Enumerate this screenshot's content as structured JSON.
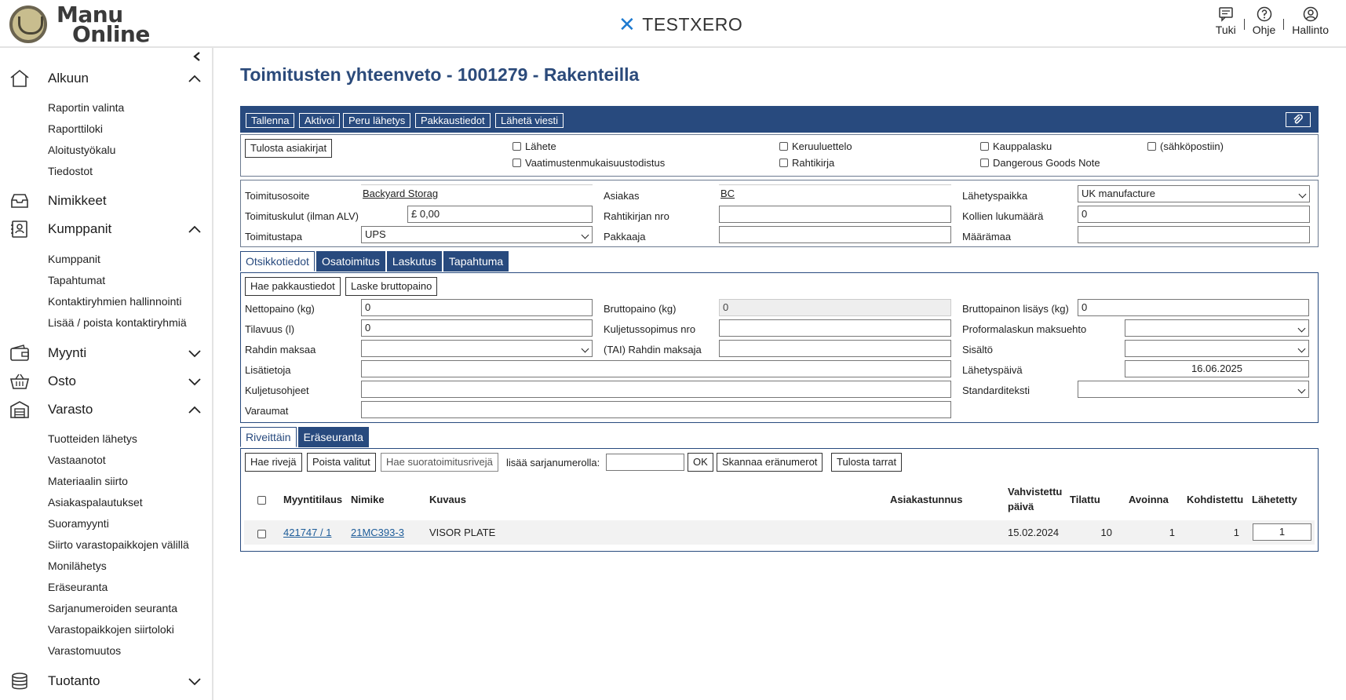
{
  "header": {
    "logo_line1": "Manu",
    "logo_line2": "Online",
    "brand": "TESTXERO",
    "links": [
      {
        "label": "Tuki",
        "icon": "chat-icon"
      },
      {
        "label": "Ohje",
        "icon": "help-icon"
      },
      {
        "label": "Hallinto",
        "icon": "user-icon"
      }
    ],
    "separator": "|"
  },
  "sidebar": {
    "sections": [
      {
        "label": "Alkuun",
        "icon": "home-icon",
        "expanded": true,
        "items": [
          "Raportin valinta",
          "Raporttiloki",
          "Aloitustyökalu",
          "Tiedostot"
        ]
      },
      {
        "label": "Nimikkeet",
        "icon": "inbox-icon"
      },
      {
        "label": "Kumppanit",
        "icon": "contacts-icon",
        "expanded": true,
        "items": [
          "Kumppanit",
          "Tapahtumat",
          "Kontaktiryhmien hallinnointi",
          "Lisää / poista kontaktiryhmiä"
        ]
      },
      {
        "label": "Myynti",
        "icon": "wallet-icon",
        "expanded": false
      },
      {
        "label": "Osto",
        "icon": "basket-icon",
        "expanded": false
      },
      {
        "label": "Varasto",
        "icon": "warehouse-icon",
        "expanded": true,
        "items": [
          "Tuotteiden lähetys",
          "Vastaanotot",
          "Materiaalin siirto",
          "Asiakaspalautukset",
          "Suoramyynti",
          "Siirto varastopaikkojen välillä",
          "Monilähetys",
          "Eräseuranta",
          "Sarjanumeroiden seuranta",
          "Varastopaikkojen siirtoloki",
          "Varastomuutos"
        ]
      },
      {
        "label": "Tuotanto",
        "icon": "database-icon",
        "expanded": false
      }
    ]
  },
  "page": {
    "title": "Toimitusten yhteenveto - 1001279 - Rakenteilla"
  },
  "toolbar": {
    "buttons": [
      "Tallenna",
      "Aktivoi",
      "Peru lähetys",
      "Pakkaustiedot",
      "Lähetä viesti"
    ],
    "attach_icon": "paperclip-icon"
  },
  "print": {
    "button": "Tulosta asiakirjat",
    "checkboxes": [
      "Lähete",
      "Vaatimustenmukaisuustodistus",
      "Keruuluettelo",
      "Rahtikirja",
      "Kauppalasku",
      "Dangerous Goods Note",
      "(sähköpostiin)"
    ]
  },
  "address": {
    "toimitusosoite_label": "Toimitusosoite",
    "toimitusosoite_value": "Backyard Storag",
    "toimituskulut_label": "Toimituskulut (ilman ALV)",
    "toimituskulut_value": "£ 0,00",
    "toimitustapa_label": "Toimitustapa",
    "toimitustapa_value": "UPS",
    "asiakas_label": "Asiakas",
    "asiakas_value": "BC",
    "rahtikirjan_label": "Rahtikirjan nro",
    "rahtikirjan_value": "",
    "pakkaaja_label": "Pakkaaja",
    "pakkaaja_value": "",
    "lahetyspaikka_label": "Lähetyspaikka",
    "lahetyspaikka_value": "UK manufacture",
    "kollien_label": "Kollien lukumäärä",
    "kollien_value": "0",
    "maaramaa_label": "Määrämaa",
    "maaramaa_value": ""
  },
  "header_tabs": [
    "Otsikkotiedot",
    "Osatoimitus",
    "Laskutus",
    "Tapahtuma"
  ],
  "header_fields": {
    "hae_btn": "Hae pakkaustiedot",
    "laske_btn": "Laske bruttopaino",
    "nettopaino_label": "Nettopaino (kg)",
    "nettopaino_value": "0",
    "tilavuus_label": "Tilavuus (l)",
    "tilavuus_value": "0",
    "rahdin_maksaa_label": "Rahdin maksaa",
    "rahdin_maksaa_value": "",
    "lisatietoja_label": "Lisätietoja",
    "lisatietoja_value": "",
    "kuljetusohjeet_label": "Kuljetusohjeet",
    "kuljetusohjeet_value": "",
    "varaumat_label": "Varaumat",
    "varaumat_value": "",
    "bruttopaino_label": "Bruttopaino (kg)",
    "bruttopaino_value": "0",
    "kuljetussopimus_label": "Kuljetussopimus nro",
    "kuljetussopimus_value": "",
    "tai_label": "(TAI) Rahdin maksaja",
    "tai_value": "",
    "lisays_label": "Bruttopainon lisäys (kg)",
    "lisays_value": "0",
    "proforma_label": "Proformalaskun maksuehto",
    "proforma_value": "",
    "sisalto_label": "Sisältö",
    "sisalto_value": "",
    "lahetyspaiva_label": "Lähetyspäivä",
    "lahetyspaiva_value": "16.06.2025",
    "standardi_label": "Standarditeksti",
    "standardi_value": ""
  },
  "rows_tabs": [
    "Riveittäin",
    "Eräseuranta"
  ],
  "rows_toolbar": {
    "hae_riveja": "Hae rivejä",
    "poista": "Poista valitut",
    "hae_suora": "Hae suoratoimitusrivejä",
    "sarja_label": "lisää sarjanumerolla:",
    "sarja_value": "",
    "ok": "OK",
    "skannaa": "Skannaa eränumerot",
    "tulosta": "Tulosta tarrat"
  },
  "table": {
    "headers": [
      "Myyntitilaus",
      "Nimike",
      "Kuvaus",
      "Asiakastunnus",
      "Vahvistettu",
      "päivä",
      "Tilattu",
      "Avoinna",
      "Kohdistettu",
      "Lähetetty"
    ],
    "rows": [
      {
        "myyntitilaus": "421747 / 1",
        "nimike": "21MC393-3",
        "kuvaus": "VISOR PLATE",
        "asiakastunnus": "",
        "paiva": "15.02.2024",
        "tilattu": "10",
        "avoinna": "1",
        "kohdistettu": "1",
        "lahetetty": "1"
      }
    ]
  }
}
